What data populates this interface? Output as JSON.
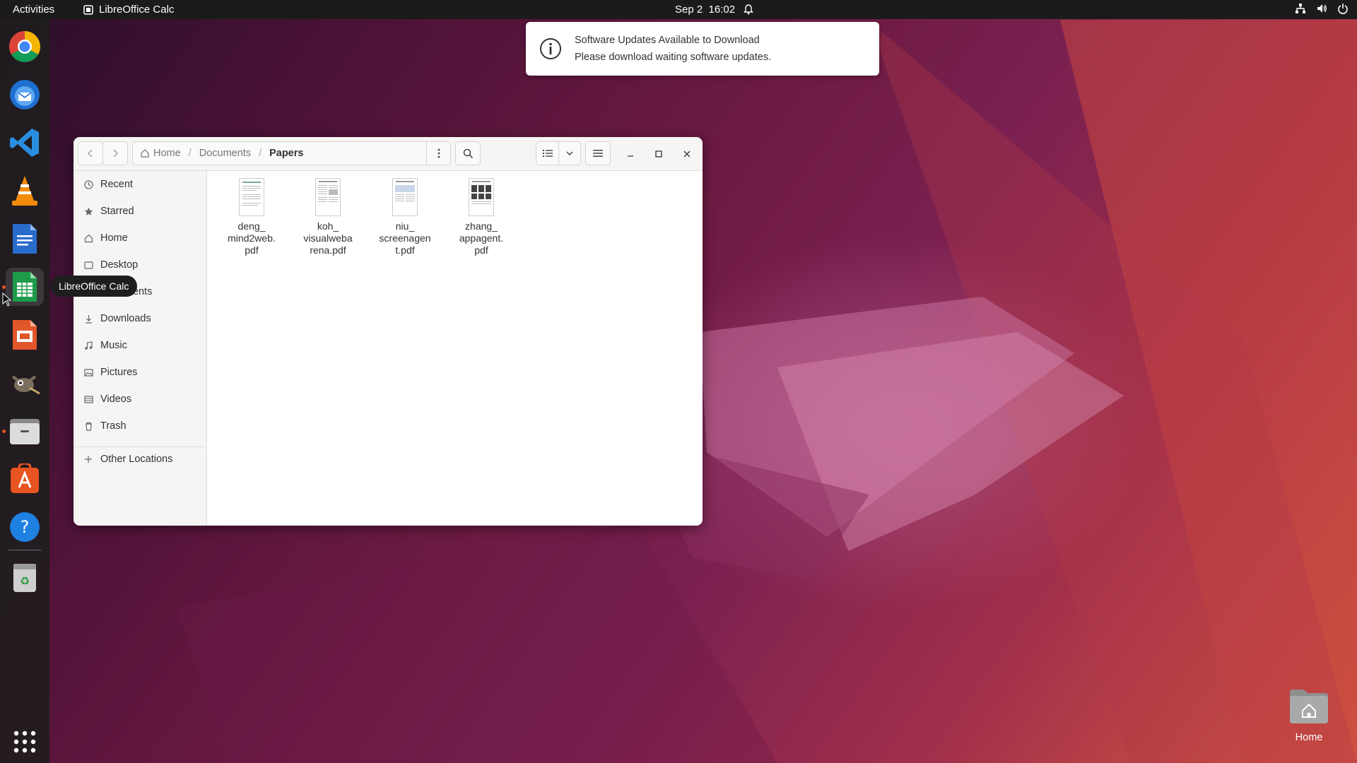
{
  "topbar": {
    "activities": "Activities",
    "app_name": "LibreOffice Calc",
    "date": "Sep 2",
    "time": "16:02"
  },
  "dock": {
    "items": [
      {
        "name": "Google Chrome",
        "icon": "chrome-icon"
      },
      {
        "name": "Thunderbird",
        "icon": "thunderbird-icon"
      },
      {
        "name": "Visual Studio Code",
        "icon": "vscode-icon"
      },
      {
        "name": "VLC",
        "icon": "vlc-icon"
      },
      {
        "name": "LibreOffice Writer",
        "icon": "writer-icon"
      },
      {
        "name": "LibreOffice Calc",
        "icon": "calc-icon"
      },
      {
        "name": "LibreOffice Impress",
        "icon": "impress-icon"
      },
      {
        "name": "GIMP",
        "icon": "gimp-icon"
      },
      {
        "name": "Files",
        "icon": "files-icon"
      },
      {
        "name": "Ubuntu Software",
        "icon": "software-icon"
      },
      {
        "name": "Help",
        "icon": "help-icon"
      },
      {
        "name": "Trash",
        "icon": "trash-icon"
      }
    ],
    "tooltip": "LibreOffice Calc"
  },
  "notification": {
    "title": "Software Updates Available to Download",
    "body": "Please download waiting software updates."
  },
  "files_window": {
    "path": {
      "home": "Home",
      "documents": "Documents",
      "current": "Papers"
    },
    "sidebar": [
      {
        "label": "Recent",
        "icon": "clock-icon"
      },
      {
        "label": "Starred",
        "icon": "star-icon"
      },
      {
        "label": "Home",
        "icon": "home-icon"
      },
      {
        "label": "Desktop",
        "icon": "desktop-icon"
      },
      {
        "label": "Documents",
        "icon": "documents-icon"
      },
      {
        "label": "Downloads",
        "icon": "download-icon"
      },
      {
        "label": "Music",
        "icon": "music-icon"
      },
      {
        "label": "Pictures",
        "icon": "pictures-icon"
      },
      {
        "label": "Videos",
        "icon": "videos-icon"
      },
      {
        "label": "Trash",
        "icon": "trash-icon"
      }
    ],
    "other_locations": "Other Locations",
    "files": [
      {
        "name_lines": [
          "deng_",
          "mind2web.",
          "pdf"
        ]
      },
      {
        "name_lines": [
          "koh_",
          "visualweba",
          "rena.pdf"
        ]
      },
      {
        "name_lines": [
          "niu_",
          "screenagen",
          "t.pdf"
        ]
      },
      {
        "name_lines": [
          "zhang_",
          "appagent.",
          "pdf"
        ]
      }
    ]
  },
  "desktop": {
    "home_label": "Home"
  }
}
